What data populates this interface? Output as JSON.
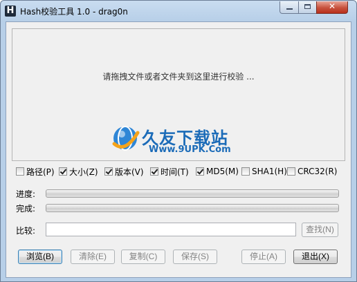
{
  "window": {
    "title": "Hash校验工具 1.0 - drag0n",
    "app_icon_letter": "H",
    "close_glyph": "✕"
  },
  "drop_area": {
    "hint": "请拖拽文件或者文件夹到这里进行校验 ...",
    "watermark_text": "久友下载站",
    "watermark_url": "Www.9UPK.Com"
  },
  "options": [
    {
      "label": "路径(P)",
      "checked": false
    },
    {
      "label": "大小(Z)",
      "checked": true
    },
    {
      "label": "版本(V)",
      "checked": true
    },
    {
      "label": "时间(T)",
      "checked": true
    },
    {
      "label": "MD5(M)",
      "checked": true
    },
    {
      "label": "SHA1(H)",
      "checked": false
    },
    {
      "label": "CRC32(R)",
      "checked": false
    }
  ],
  "progress": {
    "current_label": "进度:",
    "current_value": 0,
    "total_label": "完成:",
    "total_value": 0
  },
  "compare": {
    "label": "比较:",
    "value": "",
    "find_button": "查找(N)"
  },
  "buttons": {
    "browse": "浏览(B)",
    "clear": "清除(E)",
    "copy": "复制(C)",
    "save": "保存(S)",
    "stop": "停止(A)",
    "exit": "退出(X)"
  },
  "colors": {
    "watermark_blue": "#1b6bb8",
    "window_frame": "#b7cfe8",
    "close_red": "#c7513d"
  }
}
